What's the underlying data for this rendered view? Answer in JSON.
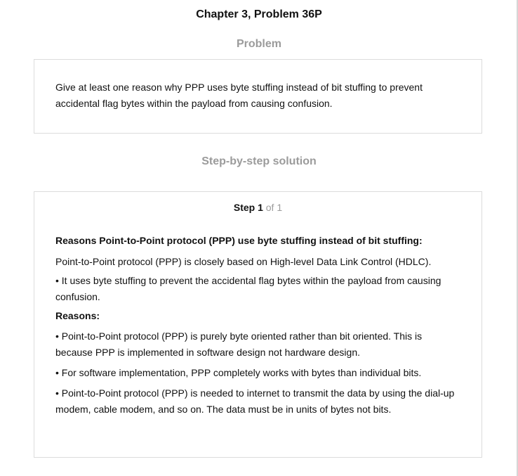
{
  "page": {
    "chapter_title": "Chapter 3, Problem 36P",
    "problem_heading": "Problem",
    "solution_heading": "Step-by-step solution"
  },
  "problem": {
    "text": "Give at least one reason why PPP uses byte stuffing instead of bit stuffing to prevent accidental flag bytes within the payload from causing confusion."
  },
  "solution": {
    "step_label": "Step 1",
    "step_of": "of 1",
    "heading": "Reasons Point-to-Point protocol (PPP) use byte stuffing instead of bit stuffing:",
    "intro": "Point-to-Point protocol (PPP) is closely based on High-level Data Link Control (HDLC).",
    "point_1": "• It uses byte stuffing to prevent the accidental flag bytes within the payload from causing confusion.",
    "reasons_heading": "Reasons:",
    "reasons": [
      "• Point-to-Point protocol (PPP) is purely byte oriented rather than bit oriented. This is because PPP is implemented in software design not hardware design.",
      "• For software implementation, PPP completely works with bytes than individual bits.",
      "• Point-to-Point protocol (PPP) is needed to internet to transmit the data by using the dial-up modem, cable modem, and so on. The data must be in units of bytes not bits."
    ]
  },
  "colors": {
    "heading_gray": "#9b9b9b",
    "border_gray": "#dcdcdc",
    "text": "#111111"
  }
}
